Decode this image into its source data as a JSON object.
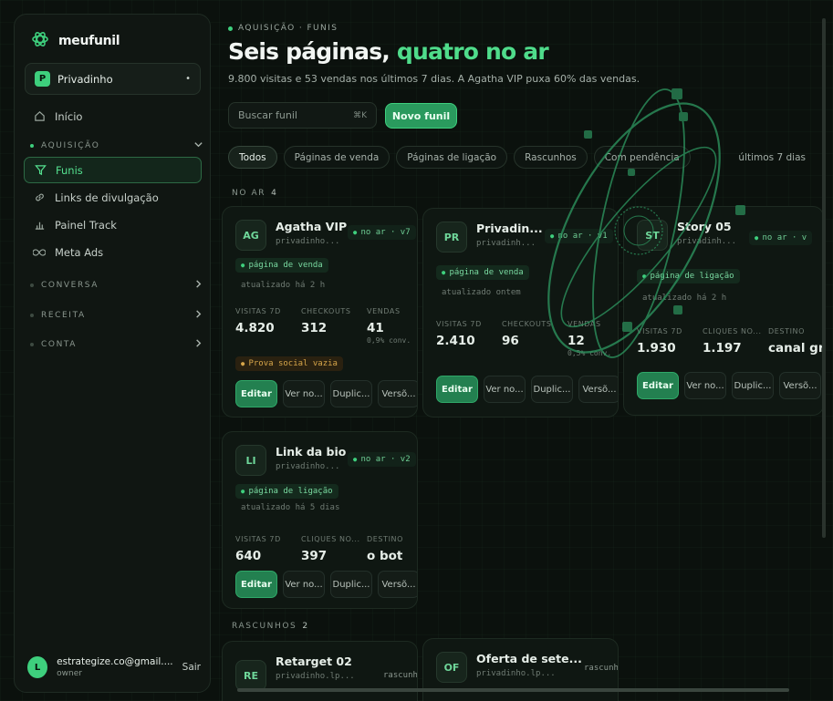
{
  "brand": {
    "name": "meufunil"
  },
  "workspace": {
    "initial": "P",
    "name": "Privadinho",
    "menu_glyph": "•"
  },
  "nav": {
    "home": "Início",
    "sections": {
      "acquisition": "AQUISIÇÃO",
      "conversation": "CONVERSA",
      "revenue": "RECEITA",
      "account": "CONTA"
    },
    "acquisition_items": [
      {
        "label": "Funis",
        "icon": "funnel-icon"
      },
      {
        "label": "Links de divulgação",
        "icon": "link-icon"
      },
      {
        "label": "Painel Track",
        "icon": "bar-chart-icon"
      },
      {
        "label": "Meta Ads",
        "icon": "infinity-icon"
      }
    ]
  },
  "account": {
    "initial": "L",
    "email": "estrategize.co@gmail....",
    "role": "owner",
    "logout": "Sair"
  },
  "header": {
    "breadcrumb": "AQUISIÇÃO · FUNIS",
    "title_a": "Seis páginas, ",
    "title_b": "quatro no ar",
    "subtitle": "9.800 visitas e 53 vendas nos últimos 7 dias. A Agatha VIP puxa 60% das vendas."
  },
  "search": {
    "placeholder": "Buscar funil",
    "shortcut": "⌘K"
  },
  "new_button": "Novo funil",
  "filters": [
    "Todos",
    "Páginas de venda",
    "Páginas de ligação",
    "Rascunhos",
    "Com pendência"
  ],
  "period": "últimos 7 dias",
  "groups": {
    "live": "NO AR",
    "live_count": "4",
    "drafts": "RASCUNHOS",
    "drafts_count": "2"
  },
  "actions": {
    "edit": "Editar",
    "view": "Ver no...",
    "duplicate": "Duplic...",
    "versions": "Versõ..."
  },
  "cards": [
    {
      "initials": "AG",
      "name": "Agatha VIP",
      "slug": "privadinho...",
      "status": "no ar · v7",
      "tag": "página de venda",
      "updated": "atualizado há 2 h",
      "stats": [
        {
          "l": "VISITAS  7D",
          "v": "4.820",
          "s": ""
        },
        {
          "l": "CHECKOUTS",
          "v": "312",
          "s": ""
        },
        {
          "l": "VENDAS",
          "v": "41",
          "s": "0,9% conv."
        }
      ],
      "warning": "Prova social vazia"
    },
    {
      "initials": "PR",
      "name": "Privadin...",
      "slug": "privadinh...",
      "status": "no ar · v1",
      "tag": "página de venda",
      "updated": "atualizado ontem",
      "stats": [
        {
          "l": "VISITAS  7D",
          "v": "2.410",
          "s": ""
        },
        {
          "l": "CHECKOUTS",
          "v": "96",
          "s": ""
        },
        {
          "l": "VENDAS",
          "v": "12",
          "s": "0,5% conv."
        }
      ]
    },
    {
      "initials": "ST",
      "name": "Story 05",
      "slug": "privadinh...",
      "status": "no ar · v",
      "tag": "página de ligação",
      "updated": "atualizado há 2 h",
      "stats": [
        {
          "l": "VISITAS  7D",
          "v": "1.930",
          "s": ""
        },
        {
          "l": "CLIQUES NO...",
          "v": "1.197",
          "s": ""
        },
        {
          "l": "DESTINO",
          "v": "canal gr",
          "s": ""
        }
      ]
    },
    {
      "initials": "LI",
      "name": "Link da bio",
      "slug": "privadinho...",
      "status": "no ar · v2",
      "tag": "página de ligação",
      "updated": "atualizado há 5 dias",
      "stats": [
        {
          "l": "VISITAS  7D",
          "v": "640",
          "s": ""
        },
        {
          "l": "CLIQUES NO...",
          "v": "397",
          "s": ""
        },
        {
          "l": "DESTINO",
          "v": "o bot",
          "s": ""
        }
      ]
    },
    {
      "initials": "RE",
      "name": "Retarget 02",
      "slug": "privadinho.lp...",
      "status": "rascunho"
    },
    {
      "initials": "OF",
      "name": "Oferta de sete...",
      "slug": "privadinho.lp...",
      "status": "rascunho"
    }
  ],
  "colors": {
    "accent": "#3ecf7d",
    "background": "#0b110d",
    "warning": "#d7a64a"
  }
}
